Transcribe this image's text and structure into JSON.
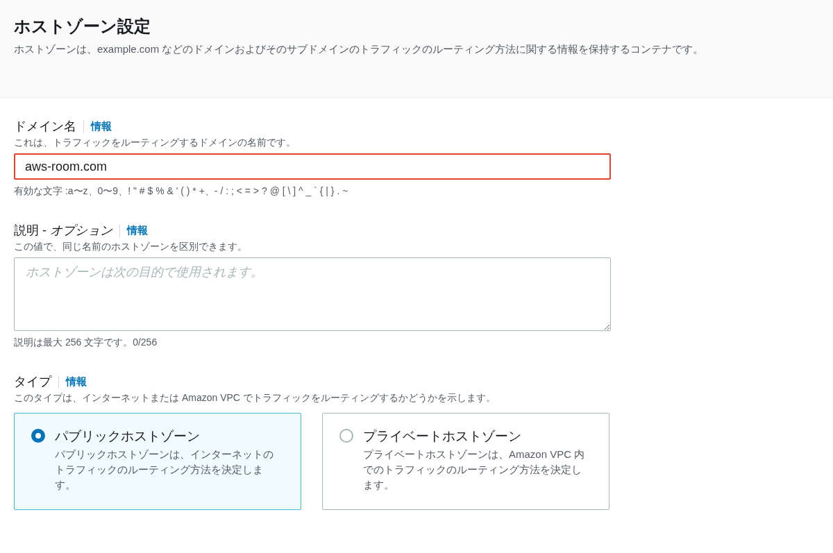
{
  "header": {
    "title": "ホストゾーン設定",
    "description": "ホストゾーンは、example.com などのドメインおよびそのサブドメインのトラフィックのルーティング方法に関する情報を保持するコンテナです。"
  },
  "fields": [
    {
      "kind": "input",
      "label": "ドメイン名",
      "info": "情報",
      "description": "これは、トラフィックをルーティングするドメインの名前です。",
      "value": "aws-room.com",
      "highlighted": true,
      "constraint": "有効な文字 :a〜z、0〜9、! \" # $ % & ' ( ) * +、- / : ; < = > ? @ [ \\ ] ^ _ ` { | } . ~"
    },
    {
      "kind": "textarea",
      "label": "説明 - ",
      "label_optional": "オプション",
      "info": "情報",
      "description": "この値で、同じ名前のホストゾーンを区別できます。",
      "placeholder": "ホストゾーンは次の目的で使用されます。",
      "constraint": "説明は最大 256 文字です。0/256"
    },
    {
      "kind": "radio",
      "label": "タイプ",
      "info": "情報",
      "description": "このタイプは、インターネットまたは Amazon VPC でトラフィックをルーティングするかどうかを示します。",
      "options": [
        {
          "title": "パブリックホストゾーン",
          "description": "パブリックホストゾーンは、インターネットのトラフィックのルーティング方法を決定します。",
          "selected": true
        },
        {
          "title": "プライベートホストゾーン",
          "description": "プライベートホストゾーンは、Amazon VPC 内でのトラフィックのルーティング方法を決定します。",
          "selected": false
        }
      ]
    }
  ]
}
